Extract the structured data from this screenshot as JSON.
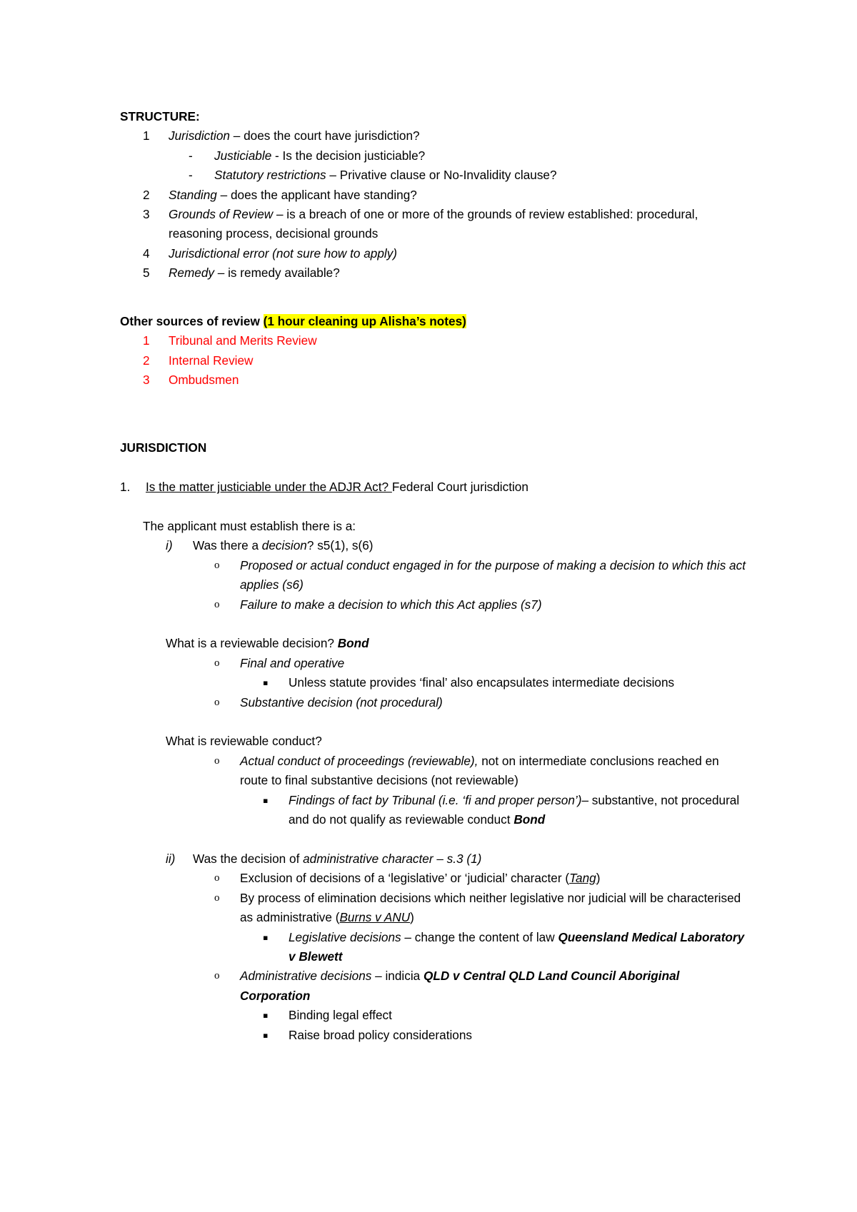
{
  "document": {
    "structure_heading": "STRUCTURE:",
    "structure_items": [
      {
        "num": "1",
        "em": "Jurisdiction",
        "rest": " – does the court have jurisdiction?"
      },
      {
        "num": "2",
        "em": "Standing",
        "rest": " – does the applicant have standing?"
      },
      {
        "num": "3",
        "em": "Grounds of Review",
        "rest": " – is a breach of one or more of the grounds of review established: procedural, reasoning process, decisional grounds"
      },
      {
        "num": "4",
        "em": "Jurisdictional error (not sure how to apply)",
        "rest": ""
      },
      {
        "num": "5",
        "em": "Remedy",
        "rest": " – is remedy available?"
      }
    ],
    "structure_sub_items": [
      {
        "marker": "-",
        "em": "Justiciable",
        "rest": " - Is the decision justiciable?"
      },
      {
        "marker": "-",
        "em": "Statutory restrictions",
        "rest": " – Privative clause or No-Invalidity clause?"
      }
    ],
    "other_sources": {
      "label": "Other sources of review ",
      "highlight": "(1 hour cleaning up Alisha’s notes)",
      "items": [
        {
          "num": "1",
          "text": "Tribunal and Merits Review"
        },
        {
          "num": "2",
          "text": "Internal Review"
        },
        {
          "num": "3",
          "text": "Ombudsmen"
        }
      ]
    },
    "jurisdiction": {
      "heading": "JURISDICTION",
      "q1": {
        "num": "1.",
        "underlined": "Is the matter justiciable under the ADJR Act? ",
        "rest": " Federal Court jurisdiction"
      },
      "lead_in": "The applicant must establish there is a:",
      "point_i": {
        "marker": "i)",
        "pre": "Was there a ",
        "em": "decision",
        "post": "? s5(1), s(6)"
      },
      "point_i_bullets": [
        "Proposed or actual conduct engaged in for the purpose of making a decision to which this act applies (s6)",
        "Failure to make a decision to which this Act applies (s7)"
      ],
      "reviewable_decision": {
        "question": "What is a reviewable decision? ",
        "case": "Bond",
        "bullets": [
          {
            "text": "Final and operative",
            "style": "italic"
          },
          {
            "text": "Substantive decision (not procedural)",
            "style": "italic"
          }
        ],
        "sub_bullet": "Unless statute provides ‘final’ also encapsulates intermediate decisions"
      },
      "reviewable_conduct": {
        "question": "What is reviewable conduct?",
        "bullet_em": "Actual conduct of proceedings (reviewable),",
        "bullet_rest": " not on intermediate conclusions reached en route to final substantive decisions (not reviewable)",
        "sub_bullet_em": "Findings of fact by Tribunal (i.e. ‘fi and proper person’)",
        "sub_bullet_rest": "– substantive, not procedural and do not qualify as reviewable conduct ",
        "sub_bullet_case": "Bond"
      },
      "point_ii": {
        "marker": "ii)",
        "pre": "Was the decision of ",
        "em": "administrative character – s.3 (1)"
      },
      "point_ii_bullets": [
        {
          "pre": "Exclusion of decisions of a ‘legislative’ or ‘judicial’ character (",
          "cite": "Tang",
          "post": ")"
        },
        {
          "pre": "By process of elimination decisions which neither legislative nor judicial will be characterised as administrative (",
          "cite": "Burns v ANU",
          "post": ")"
        }
      ],
      "legislative_decisions": {
        "em": "Legislative decisions",
        "rest": " – change the content of law ",
        "case": "Queensland Medical Laboratory v Blewett"
      },
      "administrative_decisions": {
        "em": "Administrative decisions",
        "rest": " – indicia ",
        "case": "QLD v Central QLD Land Council Aboriginal Corporation",
        "sub_bullets": [
          "Binding legal effect",
          "Raise broad policy considerations"
        ]
      }
    }
  },
  "colors": {
    "highlight": "#ffff00",
    "red_text": "#ff0000",
    "body_text": "#000000"
  },
  "glyphs": {
    "circle_bullet": "o",
    "square_bullet": "▪",
    "dash_bullet": "-"
  }
}
